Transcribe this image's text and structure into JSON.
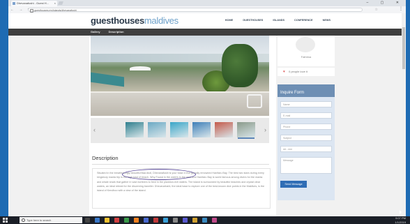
{
  "browser": {
    "tab_title": "Dhevanafushi - Guest H...",
    "url": "guesthouses.mv/islands/dhevanafushi",
    "window_controls": "– ▢ ✕",
    "nav_glyphs": "← → ⟳",
    "star": "☆",
    "menu": "⋮",
    "close_tab": "×"
  },
  "site": {
    "logo_part1": "guesthouses",
    "logo_part2": "maldives",
    "nav": [
      "HOME",
      "GUESTHOUSES",
      "ISLANDS",
      "CONFERENCE",
      "NEWS"
    ],
    "subnav": [
      "Gallery",
      "Description"
    ]
  },
  "gallery": {
    "prev": "‹",
    "next": "›",
    "thumb_colors": [
      "#2f7f8e",
      "#6ba9c4",
      "#3aa6c8",
      "#3e7fb8",
      "#c45a4a",
      "#8a9a8a"
    ]
  },
  "description": {
    "title": "Description",
    "body": "Situated in the breathtakingly beautiful Baa Atoll, Dhevanafushi is your base in the globally renowned Hanifaru Bay. The best two stars during every kingsbury manta trip is the high kind of beach. Why Found in the waters in the area and Hanifaru Bay is world famous among divers for the manta and whale shark that gather in vast numbers to feed in the plankton-rich waters. The island is surrounded by beautiful beaches and crystal clear waters, an ideal retreat for the discerning traveller. Dhevanafushi, the ideal base to explore one of the best-known dive points in the Maldives, is the island of Kendhoo with a view of the island."
  },
  "sidebar": {
    "profile_name": "Fathima",
    "likes": "0 people love it",
    "inquire_title": "Inquire Form",
    "fields": [
      "Name",
      "E-mail",
      "Phone",
      "Subject",
      "dd - mm",
      "Message"
    ],
    "send": "Send Message"
  },
  "taskbar": {
    "search_placeholder": "Type here to search",
    "time": "9:07 PM",
    "date": "1/1/2019",
    "icon_colors": [
      "#444",
      "#3a78c8",
      "#f0c030",
      "#d04040",
      "#3a9a4a",
      "#f08020",
      "#4a6ad0",
      "#c03a3a",
      "#3aa0d8",
      "#888",
      "#5a5ad0",
      "#d0a030",
      "#3a8ac0",
      "#c04a8a"
    ]
  }
}
